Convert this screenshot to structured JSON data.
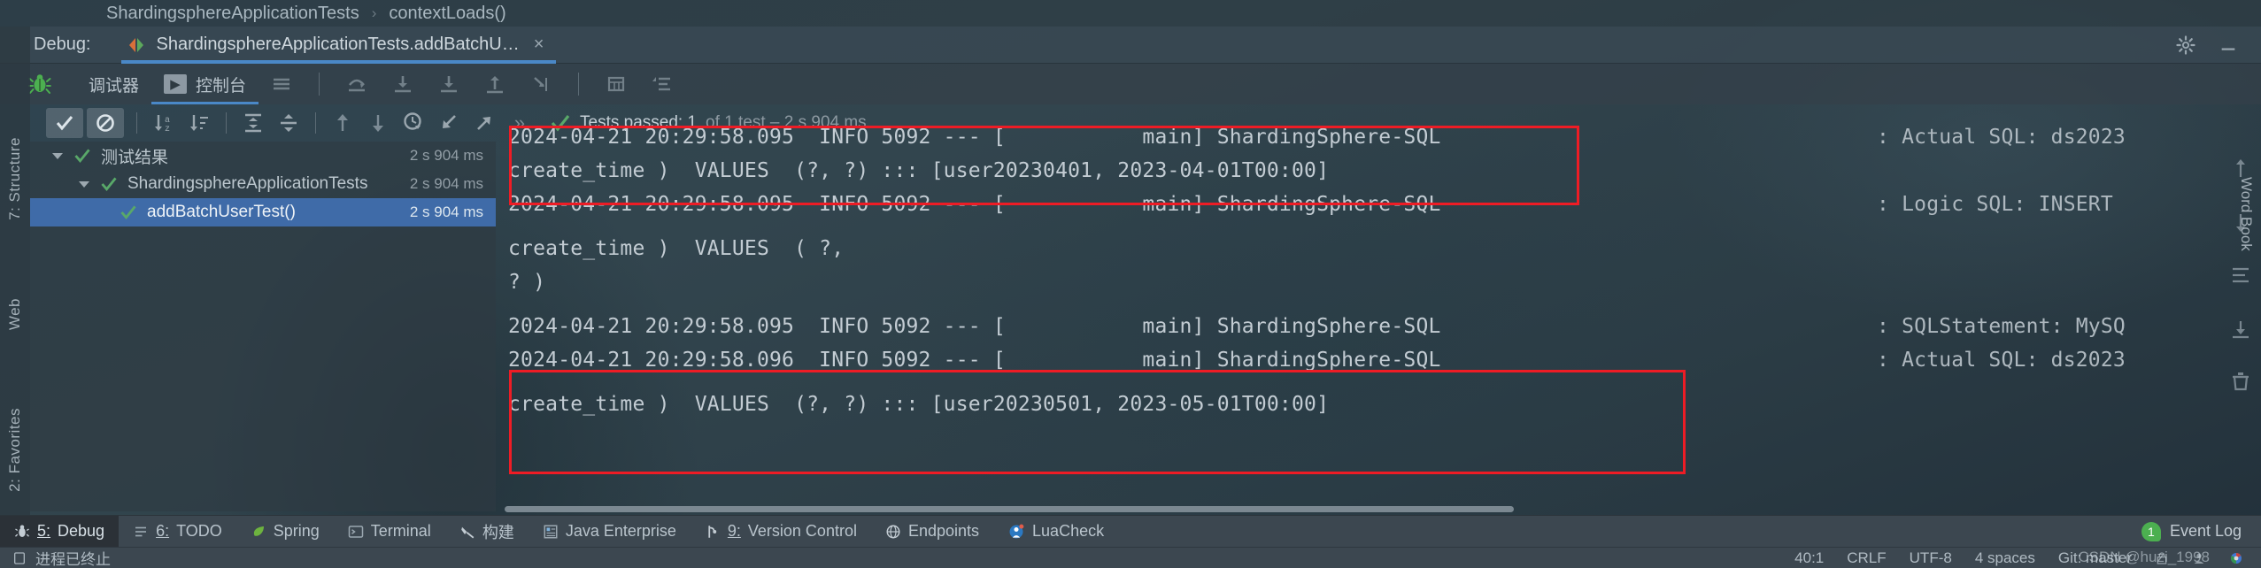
{
  "breadcrumb": {
    "items": [
      "ShardingsphereApplicationTests",
      "contextLoads()"
    ],
    "separator": "›"
  },
  "debug_header": {
    "label": "Debug:",
    "tab_title": "ShardingsphereApplicationTests.addBatchU…",
    "close": "×",
    "settings_icon": "gear-icon",
    "minimize_icon": "minimize-icon"
  },
  "tabbar": {
    "bug_icon": "bug-icon",
    "tabs": [
      {
        "label": "调试器",
        "active": false
      },
      {
        "label": "控制台",
        "active": true,
        "icon": "console-icon"
      }
    ],
    "icons": [
      "menu-lines-icon",
      "step-over-icon",
      "step-into-icon",
      "force-step-into-icon",
      "step-out-icon",
      "run-to-cursor-icon",
      "table-icon",
      "sort-lines-icon"
    ]
  },
  "toolbar2": {
    "buttons": [
      "show-passed-icon",
      "show-ignored-icon",
      "sort-alphabetically-icon",
      "sort-by-duration-icon",
      "expand-all-icon",
      "collapse-all-icon",
      "prev-failed-icon",
      "next-failed-icon",
      "history-icon",
      "import-results-icon",
      "export-results-icon",
      "more-icon"
    ],
    "more_label": "»"
  },
  "test_status": {
    "icon": "checkmark-icon",
    "main": "Tests passed: 1",
    "dim": "of 1 test – 2 s 904 ms"
  },
  "left_rail": {
    "items": [
      {
        "label": "7: Structure",
        "icon": "structure-icon"
      },
      {
        "label": "Web",
        "icon": "web-icon"
      },
      {
        "label": "2: Favorites",
        "icon": "favorites-icon"
      }
    ],
    "icons": [
      "rerun-icon",
      "resume-icon",
      "stop-icon",
      "bean-icon",
      "blocked-icon",
      "camera-icon",
      "settings-icon",
      "pin-icon",
      "star-icon"
    ]
  },
  "right_rail": {
    "label": "Word Book"
  },
  "tree": {
    "rows": [
      {
        "label": "测试结果",
        "duration": "2 s 904 ms",
        "indent": 0,
        "expanded": true,
        "selected": false
      },
      {
        "label": "ShardingsphereApplicationTests",
        "duration": "2 s 904 ms",
        "indent": 1,
        "expanded": true,
        "selected": false
      },
      {
        "label": "addBatchUserTest()",
        "duration": "2 s 904 ms",
        "indent": 2,
        "expanded": false,
        "selected": true
      }
    ]
  },
  "console": {
    "lines": [
      {
        "text": "2024-04-21 20:29:58.095  INFO 5092 --- [           main] ShardingSphere-SQL",
        "tail": ": Actual SQL: ds2023",
        "clipped": true
      },
      {
        "text": "create_time )  VALUES  (?, ?) ::: [user20230401, 2023-04-01T00:00]",
        "tail": ""
      },
      {
        "text": "2024-04-21 20:29:58.095  INFO 5092 --- [           main] ShardingSphere-SQL",
        "tail": ": Logic SQL: INSERT"
      },
      {
        "text": "create_time )  VALUES  ( ?,",
        "tail": ""
      },
      {
        "text": "? )",
        "tail": ""
      },
      {
        "text": "2024-04-21 20:29:58.095  INFO 5092 --- [           main] ShardingSphere-SQL",
        "tail": ": SQLStatement: MySQ"
      },
      {
        "text": "2024-04-21 20:29:58.096  INFO 5092 --- [           main] ShardingSphere-SQL",
        "tail": ": Actual SQL: ds2023"
      },
      {
        "text": "create_time )  VALUES  (?, ?) ::: [user20230501, 2023-05-01T00:00]",
        "tail": ""
      }
    ],
    "gutter_icons": [
      "scroll-up-icon",
      "scroll-down-icon",
      "soft-wrap-icon",
      "export-icon",
      "trash-icon"
    ],
    "highlight_color": "#ee1c25"
  },
  "toolwindows": {
    "items": [
      {
        "num": "5:",
        "label": "Debug",
        "icon": "debug-icon",
        "active": true
      },
      {
        "num": "6:",
        "label": "TODO",
        "icon": "todo-icon",
        "active": false
      },
      {
        "num": "",
        "label": "Spring",
        "icon": "spring-leaf-icon",
        "active": false
      },
      {
        "num": "",
        "label": "Terminal",
        "icon": "terminal-icon",
        "active": false
      },
      {
        "num": "",
        "label": "构建",
        "icon": "build-hammer-icon",
        "active": false
      },
      {
        "num": "",
        "label": "Java Enterprise",
        "icon": "java-enterprise-icon",
        "active": false
      },
      {
        "num": "9:",
        "label": "Version Control",
        "icon": "version-control-icon",
        "active": false
      },
      {
        "num": "",
        "label": "Endpoints",
        "icon": "endpoints-globe-icon",
        "active": false
      },
      {
        "num": "",
        "label": "LuaCheck",
        "icon": "luacheck-icon",
        "active": false
      }
    ],
    "event_log": {
      "label": "Event Log",
      "badge": "1"
    }
  },
  "status_bar": {
    "process_icon": "terminal-small-icon",
    "process_text": "进程已终止",
    "caret": "40:1",
    "line_sep": "CRLF",
    "encoding": "UTF-8",
    "indent": "4 spaces",
    "branch": "Git: master",
    "icons": [
      "lock-icon",
      "inspector-icon",
      "browser-icon"
    ]
  },
  "watermark": {
    "text": "CSDN @huzi_1998"
  }
}
